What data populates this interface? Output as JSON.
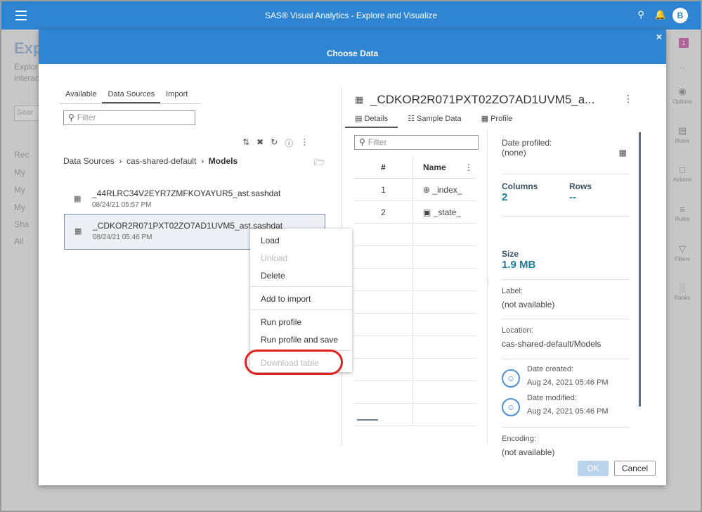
{
  "app": {
    "title": "SAS® Visual Analytics - Explore and Visualize",
    "user_initial": "B"
  },
  "background": {
    "heading": "Exp",
    "line1": "Explor",
    "line2": "interac",
    "search": "Sear",
    "nav": [
      "Rec",
      "My",
      "My",
      "My",
      "Sha",
      "All"
    ],
    "badge": "1",
    "side_panel": [
      "Options",
      "Roles",
      "Actions",
      "Rules",
      "Filters",
      "Ranks"
    ]
  },
  "dialog": {
    "title": "Choose Data",
    "close_glyph": "×",
    "tabs": [
      "Available",
      "Data Sources",
      "Import"
    ],
    "filter_placeholder": "Filter",
    "breadcrumb": {
      "root": "Data Sources",
      "lib": "cas-shared-default",
      "current": "Models"
    },
    "files": [
      {
        "name": "_44RLRC34V2EYR7ZMFKOYAYUR5_ast.sashdat",
        "date": "08/24/21 05:57 PM"
      },
      {
        "name": "_CDKOR2R071PXT02ZO7AD1UVM5_ast.sashdat",
        "date": "08/24/21 05:46 PM"
      }
    ],
    "table_title": "_CDKOR2R071PXT02ZO7AD1UVM5_a...",
    "subtabs": [
      "Details",
      "Sample Data",
      "Profile"
    ],
    "columns_filter_placeholder": "Filter",
    "columns_header": {
      "num": "#",
      "name": "Name"
    },
    "columns": [
      {
        "num": "1",
        "name": "_index_"
      },
      {
        "num": "2",
        "name": "_state_"
      }
    ],
    "info": {
      "date_profiled_label": "Date profiled:",
      "date_profiled_value": "(none)",
      "columns_label": "Columns",
      "columns_value": "2",
      "rows_label": "Rows",
      "rows_value": "--",
      "size_label": "Size",
      "size_value": "1.9 MB",
      "label_label": "Label:",
      "label_value": "(not available)",
      "location_label": "Location:",
      "location_value": "cas-shared-default/Models",
      "created_label": "Date created:",
      "created_value": "Aug 24, 2021 05:46 PM",
      "modified_label": "Date modified:",
      "modified_value": "Aug 24, 2021 05:46 PM",
      "encoding_label": "Encoding:",
      "encoding_value": "(not available)"
    },
    "ok_label": "OK",
    "cancel_label": "Cancel"
  },
  "context_menu": {
    "load": "Load",
    "unload": "Unload",
    "delete": "Delete",
    "add_to_import": "Add to import",
    "run_profile": "Run profile",
    "run_profile_save": "Run profile and save",
    "download_table": "Download table"
  },
  "colors": {
    "accent": "#2f85d1",
    "highlight": "#e0201f"
  }
}
